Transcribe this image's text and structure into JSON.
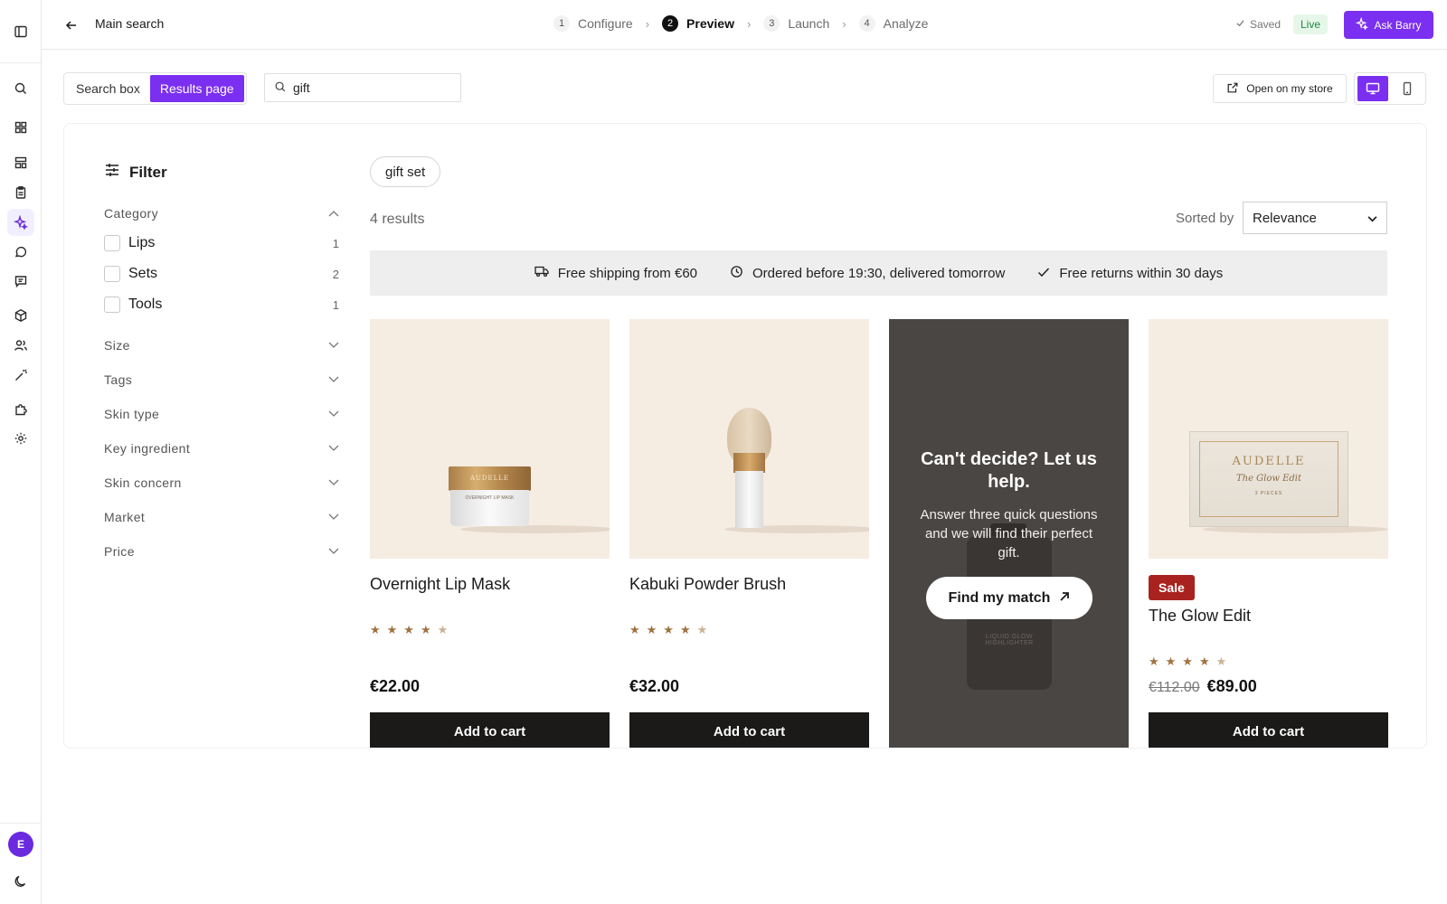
{
  "header": {
    "page_title": "Main search",
    "steps": [
      {
        "num": "1",
        "label": "Configure"
      },
      {
        "num": "2",
        "label": "Preview"
      },
      {
        "num": "3",
        "label": "Launch"
      },
      {
        "num": "4",
        "label": "Analyze"
      }
    ],
    "saved_label": "Saved",
    "live_label": "Live",
    "ask_label": "Ask Barry"
  },
  "toolbar": {
    "tabs": [
      "Search box",
      "Results page"
    ],
    "active_tab": "Results page",
    "search_value": "gift",
    "open_store_label": "Open on my store"
  },
  "filter": {
    "title": "Filter",
    "category": {
      "label": "Category",
      "options": [
        {
          "label": "Lips",
          "count": "1"
        },
        {
          "label": "Sets",
          "count": "2"
        },
        {
          "label": "Tools",
          "count": "1"
        }
      ]
    },
    "facets": [
      "Size",
      "Tags",
      "Skin type",
      "Key ingredient",
      "Skin concern",
      "Market",
      "Price"
    ]
  },
  "results": {
    "suggestion_chip": "gift set",
    "count_label": "4 results",
    "sorted_by_label": "Sorted by",
    "sort_value": "Relevance",
    "usps": [
      "Free shipping from €60",
      "Ordered before 19:30, delivered tomorrow",
      "Free returns within 30 days"
    ]
  },
  "products": [
    {
      "name": "Overnight Lip Mask",
      "price": "€22.00",
      "rating": 4.5,
      "cart_label": "Add to cart",
      "jar_text": "OVERNIGHT LIP MASK",
      "brand": "AUDELLE"
    },
    {
      "name": "Kabuki Powder Brush",
      "price": "€32.00",
      "rating": 4.5,
      "cart_label": "Add to cart"
    },
    {
      "name": "The Glow Edit",
      "old_price": "€112.00",
      "price": "€89.00",
      "badge": "Sale",
      "rating": 4.5,
      "cart_label": "Add to cart",
      "brand": "AUDELLE",
      "box_subtitle": "The Glow Edit",
      "box_pieces": "3 PIECES"
    }
  ],
  "promo": {
    "title": "Can't decide? Let us help.",
    "body": "Answer three quick questions and we will find their perfect gift.",
    "cta_label": "Find my match",
    "bottle_text": "LIQUID GLOW HIGHLIGHTER"
  },
  "user": {
    "avatar_initial": "E"
  },
  "colors": {
    "accent": "#7b2ff0",
    "sale": "#a8231f",
    "star": "#a0723f",
    "button_dark": "#1b1a19"
  }
}
